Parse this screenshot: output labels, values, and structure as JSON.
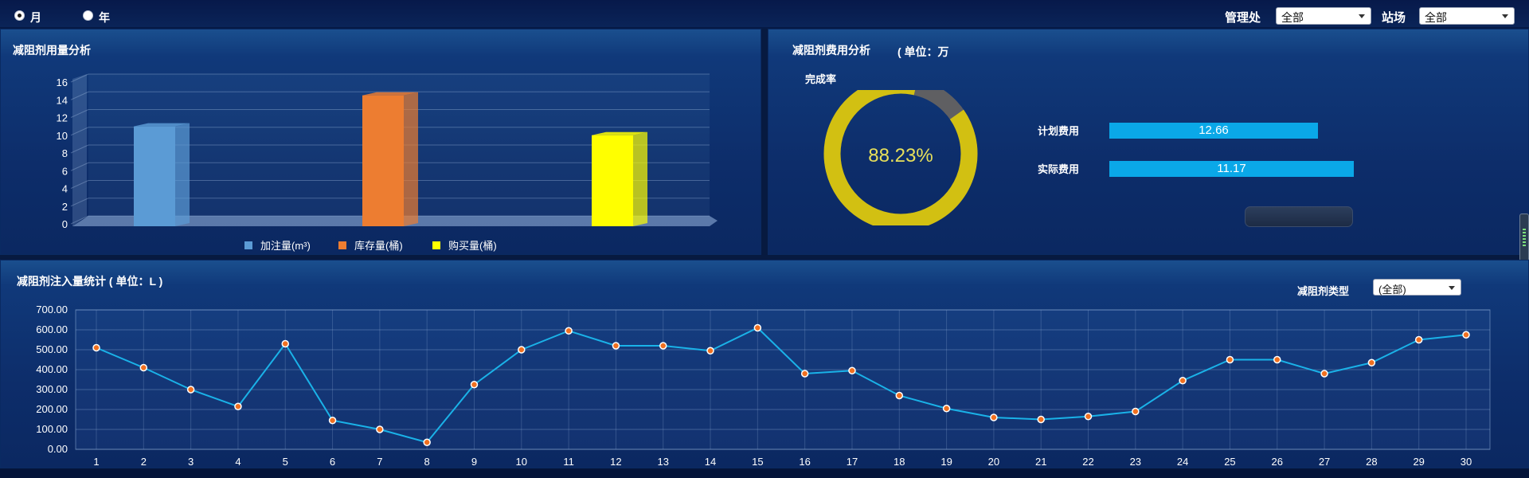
{
  "topbar": {
    "period_month": "月",
    "period_year": "年",
    "management_label": "管理处",
    "management_value": "全部",
    "station_label": "站场",
    "station_value": "全部"
  },
  "usage_panel": {
    "title": "减阻剂用量分析"
  },
  "cost_panel": {
    "title": "减阻剂费用分析",
    "unit": "( 单位：万",
    "completion_label": "完成率",
    "completion_text": "88.23%",
    "completion_rate": 88.23,
    "planned_label": "计划费用",
    "planned_value": "12.66",
    "actual_label": "实际费用",
    "actual_value": "11.17"
  },
  "injection_panel": {
    "title": "减阻剂注入量统计 ( 单位：L )",
    "type_label": "减阻剂类型",
    "type_value": "(全部)"
  },
  "chart_data": [
    {
      "type": "bar",
      "categories": [
        "加注量(m³)",
        "库存量(桶)",
        "购买量(桶)"
      ],
      "values": [
        11,
        14.5,
        10
      ],
      "legend": [
        "加注量(m³)",
        "库存量(桶)",
        "购买量(桶)"
      ],
      "colors": [
        "#5b9bd5",
        "#ed7d31",
        "#ffff00"
      ],
      "ylim": [
        0,
        16
      ],
      "yticks": [
        "0",
        "2",
        "4",
        "6",
        "8",
        "10",
        "12",
        "14",
        "16"
      ],
      "legend_position": "bottom",
      "grid": true
    },
    {
      "type": "line",
      "x": [
        "1",
        "2",
        "3",
        "4",
        "5",
        "6",
        "7",
        "8",
        "9",
        "10",
        "11",
        "12",
        "13",
        "14",
        "15",
        "16",
        "17",
        "18",
        "19",
        "20",
        "21",
        "22",
        "23",
        "24",
        "25",
        "26",
        "27",
        "28",
        "29",
        "30"
      ],
      "values": [
        510,
        410,
        300,
        215,
        530,
        145,
        100,
        35,
        325,
        500,
        595,
        520,
        520,
        495,
        610,
        380,
        395,
        270,
        205,
        160,
        150,
        165,
        190,
        345,
        450,
        450,
        380,
        435,
        550,
        575
      ],
      "ylim": [
        0,
        700
      ],
      "yticks": [
        "0.00",
        "100.00",
        "200.00",
        "300.00",
        "400.00",
        "500.00",
        "600.00",
        "700.00"
      ],
      "line_color": "#1ab2e8",
      "marker_color": "#f07020",
      "grid": true
    }
  ]
}
